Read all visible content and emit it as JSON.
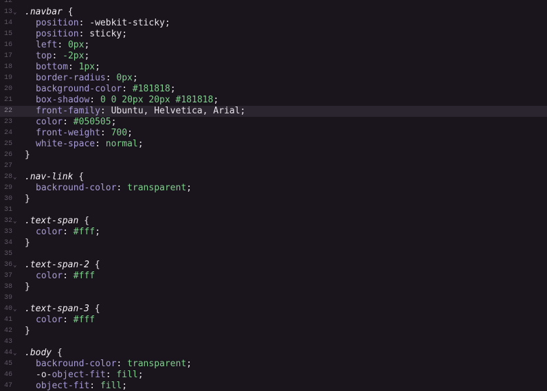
{
  "lines": [
    {
      "num": "12",
      "type": "blank"
    },
    {
      "num": "13",
      "type": "selector",
      "selector": ".navbar",
      "brace": " {",
      "fold": "⌄"
    },
    {
      "num": "14",
      "type": "decl",
      "prop": "position",
      "value": "-webkit-sticky",
      "value_kind": "plain"
    },
    {
      "num": "15",
      "type": "decl",
      "prop": "position",
      "value": "sticky",
      "value_kind": "plain"
    },
    {
      "num": "16",
      "type": "decl",
      "prop": "left",
      "value": "0px",
      "value_kind": "val"
    },
    {
      "num": "17",
      "type": "decl",
      "prop": "top",
      "value": "-2px",
      "value_kind": "val"
    },
    {
      "num": "18",
      "type": "decl",
      "prop": "bottom",
      "value": "1px",
      "value_kind": "val"
    },
    {
      "num": "19",
      "type": "decl",
      "prop": "border-radius",
      "value": "0px",
      "value_kind": "val"
    },
    {
      "num": "20",
      "type": "decl",
      "prop": "background-color",
      "value": "#181818",
      "value_kind": "val"
    },
    {
      "num": "21",
      "type": "decl",
      "prop": "box-shadow",
      "value": "0 0 20px 20px #181818",
      "value_kind": "val"
    },
    {
      "num": "22",
      "type": "decl",
      "prop": "front-family",
      "value": "Ubuntu, Helvetica, Arial",
      "value_kind": "plain",
      "active": true
    },
    {
      "num": "23",
      "type": "decl",
      "prop": "color",
      "value": "#050505",
      "value_kind": "val"
    },
    {
      "num": "24",
      "type": "decl",
      "prop": "front-weight",
      "value": "700",
      "value_kind": "val"
    },
    {
      "num": "25",
      "type": "decl",
      "prop": "white-space",
      "value": "normal",
      "value_kind": "val"
    },
    {
      "num": "26",
      "type": "close",
      "text": "}"
    },
    {
      "num": "27",
      "type": "blank"
    },
    {
      "num": "28",
      "type": "selector",
      "selector": ".nav-link",
      "brace": " {",
      "fold": "⌄"
    },
    {
      "num": "29",
      "type": "decl",
      "prop": "backround-color",
      "value": "transparent",
      "value_kind": "val"
    },
    {
      "num": "30",
      "type": "close",
      "text": "}"
    },
    {
      "num": "31",
      "type": "blank"
    },
    {
      "num": "32",
      "type": "selector",
      "selector": ".text-span",
      "brace": " {",
      "fold": "⌄"
    },
    {
      "num": "33",
      "type": "decl",
      "prop": "color",
      "value": "#fff",
      "value_kind": "val"
    },
    {
      "num": "34",
      "type": "close",
      "text": "}"
    },
    {
      "num": "35",
      "type": "blank"
    },
    {
      "num": "36",
      "type": "selector",
      "selector": ".text-span-2",
      "brace": " {",
      "fold": "⌄"
    },
    {
      "num": "37",
      "type": "decl",
      "prop": "color",
      "value": "#fff",
      "value_kind": "val",
      "no_semicolon": true
    },
    {
      "num": "38",
      "type": "close",
      "text": "}"
    },
    {
      "num": "39",
      "type": "blank"
    },
    {
      "num": "40",
      "type": "selector",
      "selector": ".text-span-3",
      "brace": " {",
      "fold": "⌄"
    },
    {
      "num": "41",
      "type": "decl",
      "prop": "color",
      "value": "#fff",
      "value_kind": "val",
      "no_semicolon": true
    },
    {
      "num": "42",
      "type": "close",
      "text": "}"
    },
    {
      "num": "43",
      "type": "blank"
    },
    {
      "num": "44",
      "type": "selector",
      "selector": ".body",
      "brace": " {",
      "fold": "⌄"
    },
    {
      "num": "45",
      "type": "decl",
      "prop": "backround-color",
      "value": "transparent",
      "value_kind": "val"
    },
    {
      "num": "46",
      "type": "decl",
      "prefix": "-o-",
      "prop": "object-fit",
      "value": "fill",
      "value_kind": "val"
    },
    {
      "num": "47",
      "type": "decl",
      "prop": "object-fit",
      "value": "fill",
      "value_kind": "val"
    }
  ],
  "colors": {
    "background": "#1a141c",
    "active_line": "#2b2530",
    "line_number": "#5f5866",
    "property": "#a79cd6",
    "value": "#7ecf8d",
    "text": "#e7e3ea"
  }
}
